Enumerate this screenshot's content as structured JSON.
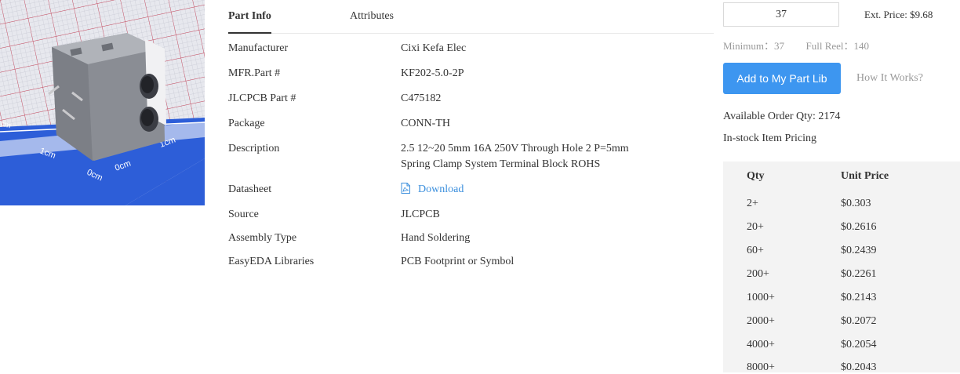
{
  "tabs": {
    "part_info": "Part Info",
    "attributes": "Attributes"
  },
  "info_rows": [
    {
      "label": "Manufacturer",
      "value": "Cixi Kefa Elec"
    },
    {
      "label": "MFR.Part #",
      "value": "KF202-5.0-2P"
    },
    {
      "label": "JLCPCB Part #",
      "value": "C475182"
    },
    {
      "label": "Package",
      "value": "CONN-TH"
    },
    {
      "label": "Description",
      "value_line1": "2.5 12~20 5mm 16A 250V Through Hole 2 P=5mm",
      "value_line2": "Spring Clamp System Terminal Block ROHS"
    },
    {
      "label": "Datasheet",
      "value": "Download",
      "icon": "pdf-icon"
    },
    {
      "label": "Source",
      "value": "JLCPCB"
    },
    {
      "label": "Assembly Type",
      "value": "Hand Soldering"
    },
    {
      "label": "EasyEDA Libraries",
      "value": "PCB Footprint or Symbol"
    }
  ],
  "order": {
    "quantity": "37",
    "ext_price": "Ext. Price: $9.68",
    "minimum_label": "Minimum：",
    "minimum_value": "37",
    "full_reel_label": "Full Reel：",
    "full_reel_value": "140",
    "add_button": "Add to My Part Lib",
    "how_it_works": "How It Works?",
    "available": "Available Order Qty: 2174",
    "instock_pricing": "In-stock Item Pricing"
  },
  "price_table": {
    "headers": {
      "qty": "Qty",
      "unit_price": "Unit Price"
    },
    "rows": [
      {
        "qty": "2+",
        "price": "$0.303"
      },
      {
        "qty": "20+",
        "price": "$0.2616"
      },
      {
        "qty": "60+",
        "price": "$0.2439"
      },
      {
        "qty": "200+",
        "price": "$0.2261"
      },
      {
        "qty": "1000+",
        "price": "$0.2143"
      },
      {
        "qty": "2000+",
        "price": "$0.2072"
      },
      {
        "qty": "4000+",
        "price": "$0.2054"
      },
      {
        "qty": "8000+",
        "price": "$0.2043"
      }
    ]
  },
  "photo_ruler_marks": [
    "1cm",
    "0cm",
    "1cm",
    "0cm",
    "cm"
  ],
  "colors": {
    "accent": "#3d96f0",
    "link": "#3b8fdd",
    "muted": "#999999",
    "table_bg": "#f3f3f3",
    "ruler_blue": "#2d5ed8"
  }
}
